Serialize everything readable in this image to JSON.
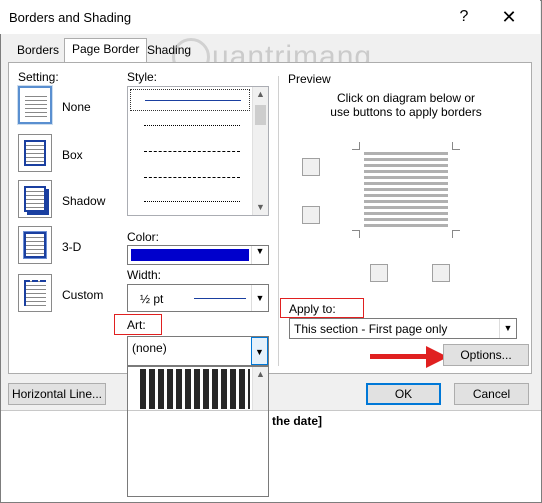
{
  "dialog": {
    "title": "Borders and Shading",
    "help": "?",
    "close": "✕"
  },
  "tabs": [
    "Borders",
    "Page Border",
    "Shading"
  ],
  "watermark": "uantrimang",
  "setting": {
    "label": "Setting:",
    "options": [
      "None",
      "Box",
      "Shadow",
      "3-D",
      "Custom"
    ]
  },
  "style": {
    "label": "Style:"
  },
  "color": {
    "label": "Color:",
    "value_hex": "#0000cc"
  },
  "width": {
    "label": "Width:",
    "value": "½ pt"
  },
  "art": {
    "label": "Art:",
    "value": "(none)"
  },
  "preview": {
    "label": "Preview",
    "instructions": "Click on diagram below or use buttons to apply borders"
  },
  "apply_to": {
    "label": "Apply to:",
    "value": "This section - First page only"
  },
  "buttons": {
    "options": "Options...",
    "horizontal_line": "Horizontal Line...",
    "ok": "OK",
    "cancel": "Cancel"
  },
  "background_text": "the date]",
  "colors": {
    "accent": "#0078d7",
    "red_annotation": "#e02020"
  }
}
